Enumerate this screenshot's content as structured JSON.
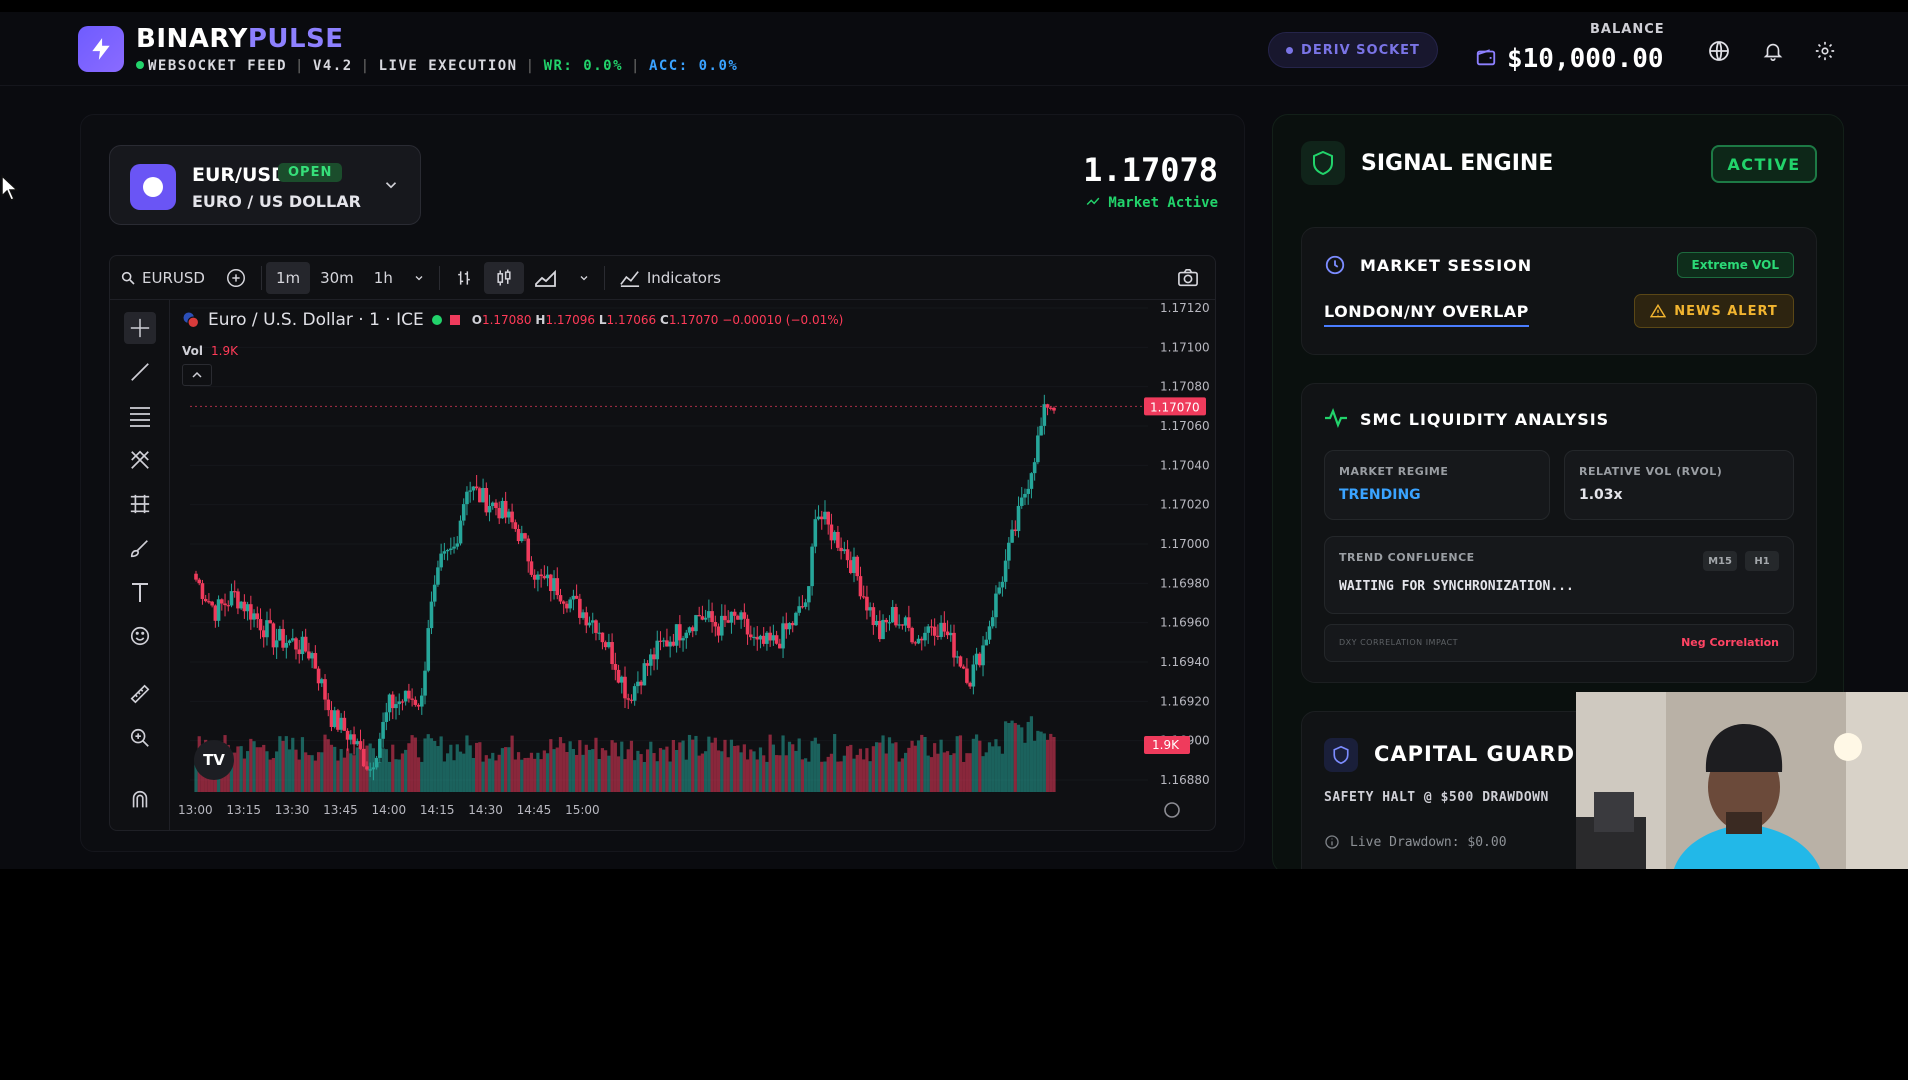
{
  "header": {
    "brand_part1": "BINARY",
    "brand_part2": "PULSE",
    "feed": "WEBSOCKET FEED",
    "version": "V4.2",
    "mode": "LIVE EXECUTION",
    "wr": "WR: 0.0%",
    "acc": "ACC: 0.0%",
    "deriv_label": "DERIV SOCKET",
    "balance_label": "BALANCE",
    "balance_value": "$10,000.00",
    "icons": [
      "bolt-icon",
      "wallet-icon",
      "globe-icon",
      "bell-icon",
      "gear-icon"
    ]
  },
  "pair": {
    "symbol": "EUR/USD",
    "status": "OPEN",
    "name": "EURO / US DOLLAR",
    "price": "1.17078",
    "market_status": "Market Active"
  },
  "chart_toolbar": {
    "symbol": "EURUSD",
    "intervals": [
      "1m",
      "30m",
      "1h"
    ],
    "active_interval": "1m",
    "indicators_label": "Indicators"
  },
  "chart_legend": {
    "title": "Euro / U.S. Dollar · 1 · ICE",
    "o_label": "O",
    "o": "1.17080",
    "h_label": "H",
    "h": "1.17096",
    "l_label": "L",
    "l": "1.17066",
    "c_label": "C",
    "c": "1.17070",
    "change": "−0.00010 (−0.01%)",
    "vol_label": "Vol",
    "vol": "1.9K"
  },
  "chart_data": {
    "type": "candlestick",
    "price_ticks": [
      "1.17120",
      "1.17100",
      "1.17080",
      "1.17060",
      "1.17040",
      "1.17020",
      "1.17000",
      "1.16980",
      "1.16960",
      "1.16940",
      "1.16920",
      "1.16900",
      "1.16880"
    ],
    "y_range": [
      1.1688,
      1.1712
    ],
    "last_price_label": "1.17070",
    "volume_label": "1.9K",
    "time_ticks": [
      "13:00",
      "13:15",
      "13:30",
      "13:45",
      "14:00",
      "14:15",
      "14:30",
      "14:45",
      "15:00"
    ],
    "colors": {
      "up": "#26a69a",
      "down": "#ef3b5c",
      "grid": "#16171b"
    },
    "close_path": [
      [
        0,
        1.16982
      ],
      [
        6,
        1.16966
      ],
      [
        12,
        1.16974
      ],
      [
        18,
        1.16964
      ],
      [
        24,
        1.16952
      ],
      [
        30,
        1.1695
      ],
      [
        36,
        1.16944
      ],
      [
        42,
        1.16912
      ],
      [
        48,
        1.16902
      ],
      [
        54,
        1.16886
      ],
      [
        60,
        1.16918
      ],
      [
        66,
        1.16922
      ],
      [
        70,
        1.1692
      ],
      [
        72,
        1.1696
      ],
      [
        76,
        1.1699
      ],
      [
        80,
        1.16998
      ],
      [
        84,
        1.1703
      ],
      [
        88,
        1.17024
      ],
      [
        94,
        1.17018
      ],
      [
        100,
        1.17006
      ],
      [
        106,
        1.16982
      ],
      [
        112,
        1.16978
      ],
      [
        118,
        1.16968
      ],
      [
        124,
        1.1696
      ],
      [
        130,
        1.1694
      ],
      [
        134,
        1.16922
      ],
      [
        138,
        1.16934
      ],
      [
        144,
        1.16948
      ],
      [
        150,
        1.16956
      ],
      [
        156,
        1.16964
      ],
      [
        162,
        1.16958
      ],
      [
        168,
        1.16962
      ],
      [
        174,
        1.16948
      ],
      [
        180,
        1.1695
      ],
      [
        186,
        1.16962
      ],
      [
        190,
        1.16974
      ],
      [
        192,
        1.17018
      ],
      [
        196,
        1.17008
      ],
      [
        200,
        1.17
      ],
      [
        204,
        1.16988
      ],
      [
        208,
        1.1697
      ],
      [
        212,
        1.16954
      ],
      [
        216,
        1.16964
      ],
      [
        220,
        1.16958
      ],
      [
        224,
        1.16952
      ],
      [
        228,
        1.1696
      ],
      [
        232,
        1.16956
      ],
      [
        236,
        1.16944
      ],
      [
        240,
        1.16932
      ],
      [
        244,
        1.16948
      ],
      [
        248,
        1.16972
      ],
      [
        252,
        1.16996
      ],
      [
        256,
        1.1702
      ],
      [
        260,
        1.17046
      ],
      [
        264,
        1.17072
      ],
      [
        266,
        1.1707
      ]
    ],
    "minutes_per_candle": 1
  },
  "signal_engine": {
    "title": "SIGNAL ENGINE",
    "status": "ACTIVE",
    "session": {
      "title": "MARKET SESSION",
      "badge": "Extreme VOL",
      "name": "LONDON/NY OVERLAP",
      "alert": "NEWS ALERT"
    },
    "smc": {
      "title": "SMC LIQUIDITY ANALYSIS",
      "regime_label": "MARKET REGIME",
      "regime_value": "TRENDING",
      "rvol_label": "RELATIVE VOL (RVOL)",
      "rvol_value": "1.03x",
      "confluence_label": "TREND CONFLUENCE",
      "tf1": "M15",
      "tf2": "H1",
      "confluence_value": "WAITING FOR SYNCHRONIZATION...",
      "corr_label": "DXY CORRELATION IMPACT",
      "corr_value": "Neg Correlation"
    },
    "capital": {
      "title": "CAPITAL GUARD",
      "halt": "SAFETY HALT @ $500 DRAWDOWN",
      "drawdown": "Live Drawdown: $0.00"
    }
  }
}
